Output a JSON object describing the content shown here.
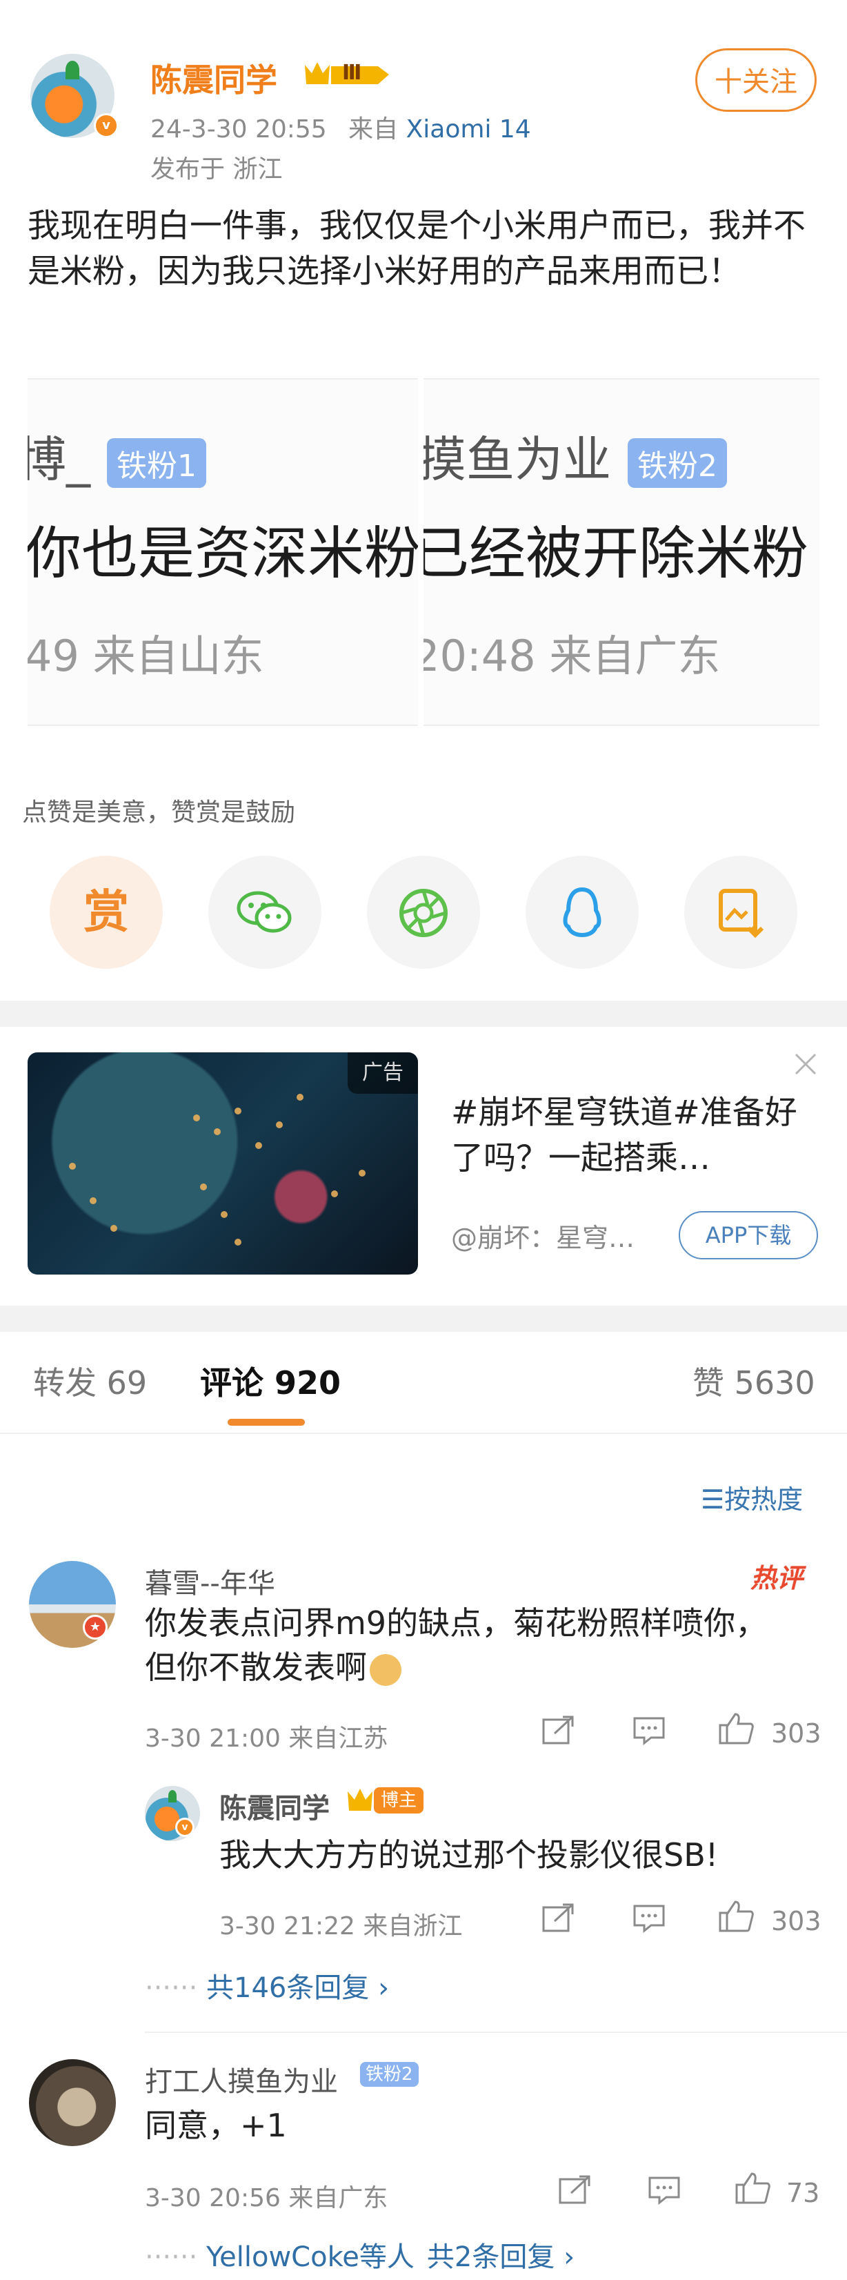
{
  "post": {
    "author": "陈震同学",
    "level_badge": "Ⅲ",
    "follow_label": "十关注",
    "date": "24-3-30 20:55",
    "from_label": "来自",
    "device": "Xiaomi 14",
    "location": "发布于 浙江",
    "text": "我现在明白一件事，我仅仅是个小米用户而已，我并不是米粉，因为我只选择小米好用的产品来用而已！"
  },
  "screenshots": [
    {
      "line1": "博_",
      "badge": "铁粉1",
      "line2": "你也是资深米粉",
      "line3": "49 来自山东"
    },
    {
      "line1": "摸鱼为业",
      "badge": "铁粉2",
      "line2": "已经被开除米粉",
      "line3": "20:48 来自广东"
    }
  ],
  "reward_tip": "点赞是美意，赞赏是鼓励",
  "share": [
    {
      "icon": "reward-icon",
      "label": "赏"
    },
    {
      "icon": "wechat-icon"
    },
    {
      "icon": "moments-icon"
    },
    {
      "icon": "qq-icon"
    },
    {
      "icon": "save-image-icon"
    }
  ],
  "ad": {
    "tag": "广告",
    "title": "#崩坏星穹铁道#准备好了吗？一起搭乘…",
    "source": "@崩坏：星穹…",
    "button": "APP下载"
  },
  "tabs": {
    "repost": "转发 69",
    "comments": "评论 920",
    "likes": "赞 5630"
  },
  "sort_label": "按热度",
  "comments": [
    {
      "name": "暮雪--年华",
      "hot_label": "热评",
      "text": "你发表点问界m9的缺点，菊花粉照样喷你，但你不散发表啊",
      "meta": "3-30 21:00 来自江苏",
      "likes": "303",
      "reply": {
        "name": "陈震同学",
        "badge": "博主",
        "text": "我大大方方的说过那个投影仪很SB!",
        "meta": "3-30 21:22 来自浙江",
        "likes": "303"
      },
      "more_replies": "共146条回复 ›"
    },
    {
      "name": "打工人摸鱼为业",
      "badge": "铁粉2",
      "text": "同意，+1",
      "meta": "3-30 20:56 来自广东",
      "likes": "73",
      "more_replies_users": "YellowCoke等人",
      "more_replies": "共2条回复 ›"
    }
  ]
}
